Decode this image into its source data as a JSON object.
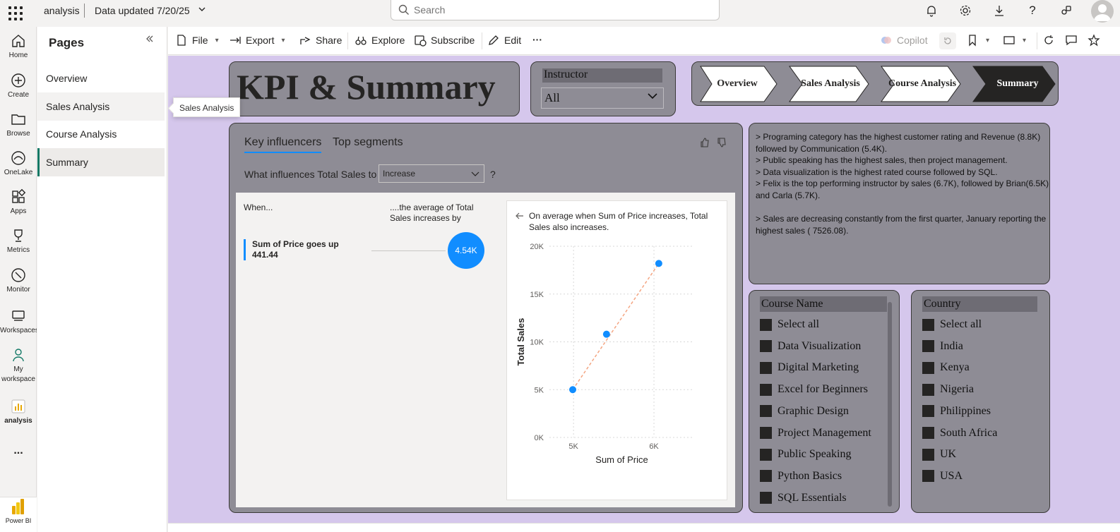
{
  "topbar": {
    "app_name": "analysis",
    "data_updated": "Data updated 7/20/25",
    "search_placeholder": "Search"
  },
  "rail": {
    "items": [
      {
        "label": "Home"
      },
      {
        "label": "Create"
      },
      {
        "label": "Browse"
      },
      {
        "label": "OneLake"
      },
      {
        "label": "Apps"
      },
      {
        "label": "Metrics"
      },
      {
        "label": "Monitor"
      },
      {
        "label": "Workspaces"
      },
      {
        "label": "My workspace"
      },
      {
        "label": "analysis"
      }
    ],
    "more": "...",
    "powerbi_label": "Power BI"
  },
  "pages": {
    "title": "Pages",
    "items": [
      {
        "label": "Overview"
      },
      {
        "label": "Sales Analysis"
      },
      {
        "label": "Course Analysis"
      },
      {
        "label": "Summary"
      }
    ],
    "tooltip": "Sales Analysis"
  },
  "toolbar": {
    "file": "File",
    "export": "Export",
    "share": "Share",
    "explore": "Explore",
    "subscribe": "Subscribe",
    "edit": "Edit",
    "more": "···",
    "copilot": "Copilot"
  },
  "report": {
    "kpi_title": "KPI & Summary",
    "instructor_slicer": {
      "label": "Instructor",
      "value": "All"
    },
    "nav_buttons": [
      {
        "label": "Overview"
      },
      {
        "label": "Sales Analysis"
      },
      {
        "label": "Course Analysis"
      },
      {
        "label": "Summary"
      }
    ],
    "key_influencers": {
      "tab_active": "Key influencers",
      "tab_other": "Top segments",
      "question": "What influences Total Sales to",
      "select_value": "Increase",
      "question_mark": "?",
      "when": "When...",
      "avg_header": "....the average of Total Sales increases by",
      "factor": "Sum of Price goes up 441.44",
      "effect": "4.54K",
      "detail_text": "On average when Sum of Price increases, Total Sales also increases."
    },
    "summary_text": "> Programing category has the highest customer rating and Revenue (8.8K) followed by Communication (5.4K).\n> Public speaking has the highest sales, then project management.\n> Data visualization is the highest rated course followed by SQL.\n> Felix is the top performing instructor by sales (6.7K), followed by Brian(6.5K) and Carla (5.7K).\n\n> Sales are decreasing constantly from the first quarter, January reporting the highest sales ( 7526.08).",
    "course_slicer": {
      "title": "Course Name",
      "items": [
        "Select all",
        "Data Visualization",
        "Digital Marketing",
        "Excel for Beginners",
        "Graphic Design",
        "Project Management",
        "Public Speaking",
        "Python Basics",
        "SQL Essentials"
      ]
    },
    "country_slicer": {
      "title": "Country",
      "items": [
        "Select all",
        "India",
        "Kenya",
        "Nigeria",
        "Philippines",
        "South Africa",
        "UK",
        "USA"
      ]
    }
  },
  "colors": {
    "canvas_bg": "#d5c7ec",
    "card_bg": "#8e8c95",
    "accent_blue": "#118dff",
    "trend_line": "#f4a582",
    "active_page": "#117865"
  },
  "chart_data": {
    "type": "scatter",
    "xlabel": "Sum of Price",
    "ylabel": "Total Sales",
    "x_ticks": [
      "5K",
      "6K"
    ],
    "y_ticks": [
      "0K",
      "5K",
      "10K",
      "15K",
      "20K"
    ],
    "xlim": [
      4700,
      6500
    ],
    "ylim": [
      0,
      20000
    ],
    "points": [
      {
        "x": 4990,
        "y": 5000
      },
      {
        "x": 5410,
        "y": 10800
      },
      {
        "x": 6060,
        "y": 18200
      }
    ],
    "trend_line": true,
    "grid": true
  }
}
